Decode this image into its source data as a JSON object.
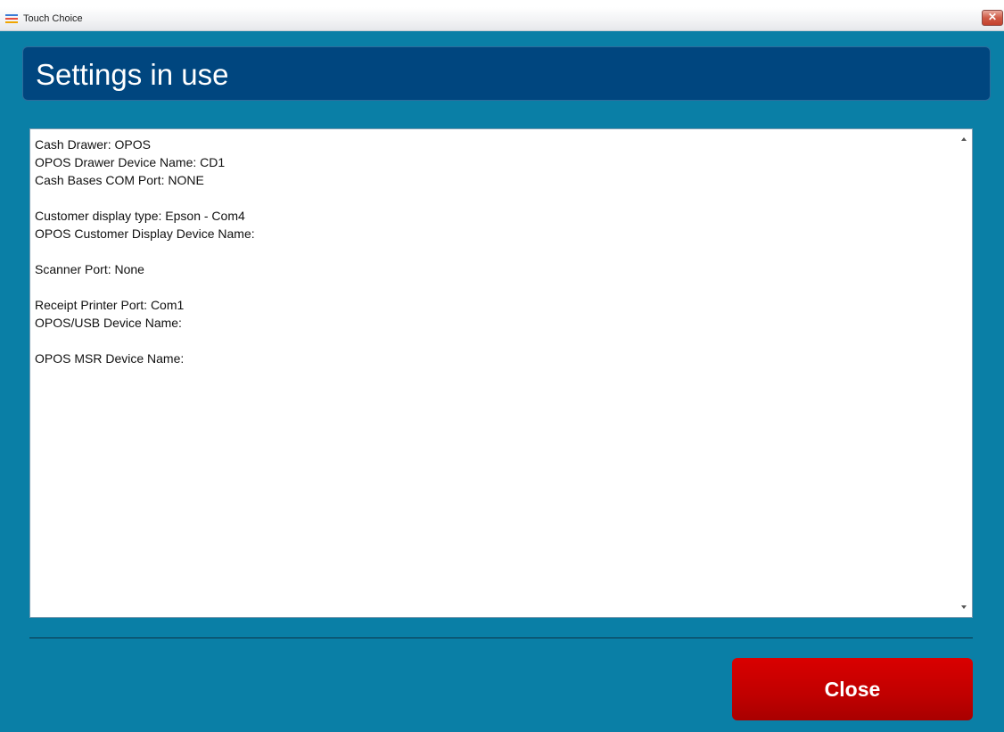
{
  "window": {
    "title": "Touch Choice",
    "icon": "app-icon",
    "close_glyph": "✕"
  },
  "header": {
    "title": "Settings in use"
  },
  "settings": {
    "lines": [
      "Cash Drawer: OPOS",
      "OPOS Drawer Device Name: CD1",
      "Cash Bases COM Port: NONE",
      "",
      "Customer display type: Epson - Com4",
      "OPOS Customer Display Device Name:",
      "",
      "Scanner Port: None",
      "",
      "Receipt Printer Port: Com1",
      "OPOS/USB Device Name:",
      "",
      "OPOS MSR Device Name:"
    ]
  },
  "footer": {
    "close_label": "Close"
  },
  "colors": {
    "background": "#0a7fa6",
    "header": "#00467f",
    "close_button": "#c00000"
  }
}
